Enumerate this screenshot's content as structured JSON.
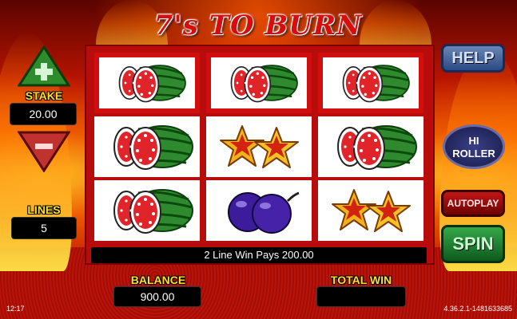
{
  "title": "7's TO BURN",
  "stake": {
    "label": "STAKE",
    "value": "20.00"
  },
  "lines": {
    "label": "LINES",
    "value": "5"
  },
  "balance": {
    "label": "BALANCE",
    "value": "900.00"
  },
  "total_win": {
    "label": "TOTAL WIN",
    "value": ""
  },
  "win_message": "2 Line Win Pays 200.00",
  "buttons": {
    "help": "HELP",
    "hi_roller_line1": "HI",
    "hi_roller_line2": "ROLLER",
    "autoplay": "AUTOPLAY",
    "spin": "SPIN"
  },
  "status": {
    "clock": "12:17",
    "version": "4.36.2.1-1481633685"
  },
  "reels": [
    [
      "watermelon",
      "watermelon",
      "watermelon"
    ],
    [
      "watermelon",
      "star",
      "plum"
    ],
    [
      "watermelon",
      "watermelon",
      "star"
    ]
  ],
  "winning_row": 0,
  "colors": {
    "accent_yellow": "#ffe02a",
    "reel_frame": "#b80c0c",
    "spin_green": "#2a9a40",
    "help_blue": "#3b5c96"
  }
}
